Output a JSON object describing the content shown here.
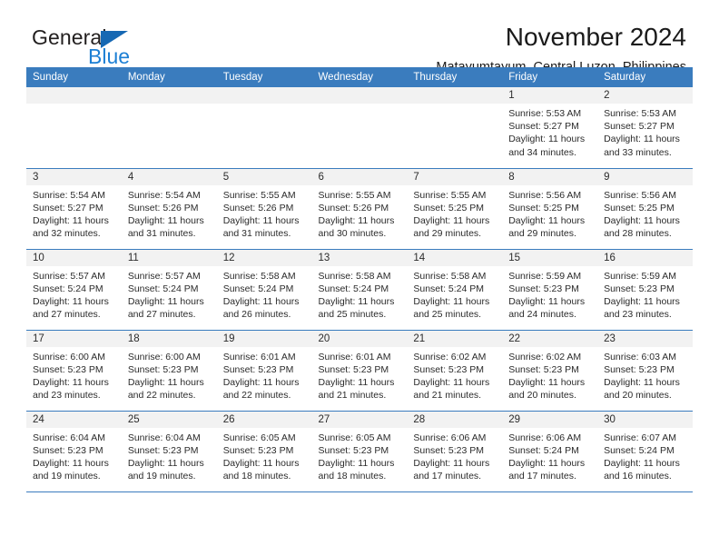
{
  "brand": {
    "name_part1": "General",
    "name_part2": "Blue",
    "triangle_color": "#1668b3",
    "blue_color": "#1c7fd4"
  },
  "header": {
    "title": "November 2024",
    "subtitle": "Matayumtayum, Central Luzon, Philippines"
  },
  "theme": {
    "header_blue": "#3a7cbe",
    "day_band_gray": "#f2f2f2",
    "text_color": "#2b2b2b"
  },
  "weekday_headers": [
    "Sunday",
    "Monday",
    "Tuesday",
    "Wednesday",
    "Thursday",
    "Friday",
    "Saturday"
  ],
  "weeks": [
    [
      {
        "day": "",
        "empty": true,
        "sunrise": "",
        "sunset": "",
        "daylight_line1": "",
        "daylight_line2": ""
      },
      {
        "day": "",
        "empty": true,
        "sunrise": "",
        "sunset": "",
        "daylight_line1": "",
        "daylight_line2": ""
      },
      {
        "day": "",
        "empty": true,
        "sunrise": "",
        "sunset": "",
        "daylight_line1": "",
        "daylight_line2": ""
      },
      {
        "day": "",
        "empty": true,
        "sunrise": "",
        "sunset": "",
        "daylight_line1": "",
        "daylight_line2": ""
      },
      {
        "day": "",
        "empty": true,
        "sunrise": "",
        "sunset": "",
        "daylight_line1": "",
        "daylight_line2": ""
      },
      {
        "day": "1",
        "empty": false,
        "sunrise": "Sunrise: 5:53 AM",
        "sunset": "Sunset: 5:27 PM",
        "daylight_line1": "Daylight: 11 hours",
        "daylight_line2": "and 34 minutes."
      },
      {
        "day": "2",
        "empty": false,
        "sunrise": "Sunrise: 5:53 AM",
        "sunset": "Sunset: 5:27 PM",
        "daylight_line1": "Daylight: 11 hours",
        "daylight_line2": "and 33 minutes."
      }
    ],
    [
      {
        "day": "3",
        "empty": false,
        "sunrise": "Sunrise: 5:54 AM",
        "sunset": "Sunset: 5:27 PM",
        "daylight_line1": "Daylight: 11 hours",
        "daylight_line2": "and 32 minutes."
      },
      {
        "day": "4",
        "empty": false,
        "sunrise": "Sunrise: 5:54 AM",
        "sunset": "Sunset: 5:26 PM",
        "daylight_line1": "Daylight: 11 hours",
        "daylight_line2": "and 31 minutes."
      },
      {
        "day": "5",
        "empty": false,
        "sunrise": "Sunrise: 5:55 AM",
        "sunset": "Sunset: 5:26 PM",
        "daylight_line1": "Daylight: 11 hours",
        "daylight_line2": "and 31 minutes."
      },
      {
        "day": "6",
        "empty": false,
        "sunrise": "Sunrise: 5:55 AM",
        "sunset": "Sunset: 5:26 PM",
        "daylight_line1": "Daylight: 11 hours",
        "daylight_line2": "and 30 minutes."
      },
      {
        "day": "7",
        "empty": false,
        "sunrise": "Sunrise: 5:55 AM",
        "sunset": "Sunset: 5:25 PM",
        "daylight_line1": "Daylight: 11 hours",
        "daylight_line2": "and 29 minutes."
      },
      {
        "day": "8",
        "empty": false,
        "sunrise": "Sunrise: 5:56 AM",
        "sunset": "Sunset: 5:25 PM",
        "daylight_line1": "Daylight: 11 hours",
        "daylight_line2": "and 29 minutes."
      },
      {
        "day": "9",
        "empty": false,
        "sunrise": "Sunrise: 5:56 AM",
        "sunset": "Sunset: 5:25 PM",
        "daylight_line1": "Daylight: 11 hours",
        "daylight_line2": "and 28 minutes."
      }
    ],
    [
      {
        "day": "10",
        "empty": false,
        "sunrise": "Sunrise: 5:57 AM",
        "sunset": "Sunset: 5:24 PM",
        "daylight_line1": "Daylight: 11 hours",
        "daylight_line2": "and 27 minutes."
      },
      {
        "day": "11",
        "empty": false,
        "sunrise": "Sunrise: 5:57 AM",
        "sunset": "Sunset: 5:24 PM",
        "daylight_line1": "Daylight: 11 hours",
        "daylight_line2": "and 27 minutes."
      },
      {
        "day": "12",
        "empty": false,
        "sunrise": "Sunrise: 5:58 AM",
        "sunset": "Sunset: 5:24 PM",
        "daylight_line1": "Daylight: 11 hours",
        "daylight_line2": "and 26 minutes."
      },
      {
        "day": "13",
        "empty": false,
        "sunrise": "Sunrise: 5:58 AM",
        "sunset": "Sunset: 5:24 PM",
        "daylight_line1": "Daylight: 11 hours",
        "daylight_line2": "and 25 minutes."
      },
      {
        "day": "14",
        "empty": false,
        "sunrise": "Sunrise: 5:58 AM",
        "sunset": "Sunset: 5:24 PM",
        "daylight_line1": "Daylight: 11 hours",
        "daylight_line2": "and 25 minutes."
      },
      {
        "day": "15",
        "empty": false,
        "sunrise": "Sunrise: 5:59 AM",
        "sunset": "Sunset: 5:23 PM",
        "daylight_line1": "Daylight: 11 hours",
        "daylight_line2": "and 24 minutes."
      },
      {
        "day": "16",
        "empty": false,
        "sunrise": "Sunrise: 5:59 AM",
        "sunset": "Sunset: 5:23 PM",
        "daylight_line1": "Daylight: 11 hours",
        "daylight_line2": "and 23 minutes."
      }
    ],
    [
      {
        "day": "17",
        "empty": false,
        "sunrise": "Sunrise: 6:00 AM",
        "sunset": "Sunset: 5:23 PM",
        "daylight_line1": "Daylight: 11 hours",
        "daylight_line2": "and 23 minutes."
      },
      {
        "day": "18",
        "empty": false,
        "sunrise": "Sunrise: 6:00 AM",
        "sunset": "Sunset: 5:23 PM",
        "daylight_line1": "Daylight: 11 hours",
        "daylight_line2": "and 22 minutes."
      },
      {
        "day": "19",
        "empty": false,
        "sunrise": "Sunrise: 6:01 AM",
        "sunset": "Sunset: 5:23 PM",
        "daylight_line1": "Daylight: 11 hours",
        "daylight_line2": "and 22 minutes."
      },
      {
        "day": "20",
        "empty": false,
        "sunrise": "Sunrise: 6:01 AM",
        "sunset": "Sunset: 5:23 PM",
        "daylight_line1": "Daylight: 11 hours",
        "daylight_line2": "and 21 minutes."
      },
      {
        "day": "21",
        "empty": false,
        "sunrise": "Sunrise: 6:02 AM",
        "sunset": "Sunset: 5:23 PM",
        "daylight_line1": "Daylight: 11 hours",
        "daylight_line2": "and 21 minutes."
      },
      {
        "day": "22",
        "empty": false,
        "sunrise": "Sunrise: 6:02 AM",
        "sunset": "Sunset: 5:23 PM",
        "daylight_line1": "Daylight: 11 hours",
        "daylight_line2": "and 20 minutes."
      },
      {
        "day": "23",
        "empty": false,
        "sunrise": "Sunrise: 6:03 AM",
        "sunset": "Sunset: 5:23 PM",
        "daylight_line1": "Daylight: 11 hours",
        "daylight_line2": "and 20 minutes."
      }
    ],
    [
      {
        "day": "24",
        "empty": false,
        "sunrise": "Sunrise: 6:04 AM",
        "sunset": "Sunset: 5:23 PM",
        "daylight_line1": "Daylight: 11 hours",
        "daylight_line2": "and 19 minutes."
      },
      {
        "day": "25",
        "empty": false,
        "sunrise": "Sunrise: 6:04 AM",
        "sunset": "Sunset: 5:23 PM",
        "daylight_line1": "Daylight: 11 hours",
        "daylight_line2": "and 19 minutes."
      },
      {
        "day": "26",
        "empty": false,
        "sunrise": "Sunrise: 6:05 AM",
        "sunset": "Sunset: 5:23 PM",
        "daylight_line1": "Daylight: 11 hours",
        "daylight_line2": "and 18 minutes."
      },
      {
        "day": "27",
        "empty": false,
        "sunrise": "Sunrise: 6:05 AM",
        "sunset": "Sunset: 5:23 PM",
        "daylight_line1": "Daylight: 11 hours",
        "daylight_line2": "and 18 minutes."
      },
      {
        "day": "28",
        "empty": false,
        "sunrise": "Sunrise: 6:06 AM",
        "sunset": "Sunset: 5:23 PM",
        "daylight_line1": "Daylight: 11 hours",
        "daylight_line2": "and 17 minutes."
      },
      {
        "day": "29",
        "empty": false,
        "sunrise": "Sunrise: 6:06 AM",
        "sunset": "Sunset: 5:24 PM",
        "daylight_line1": "Daylight: 11 hours",
        "daylight_line2": "and 17 minutes."
      },
      {
        "day": "30",
        "empty": false,
        "sunrise": "Sunrise: 6:07 AM",
        "sunset": "Sunset: 5:24 PM",
        "daylight_line1": "Daylight: 11 hours",
        "daylight_line2": "and 16 minutes."
      }
    ]
  ]
}
